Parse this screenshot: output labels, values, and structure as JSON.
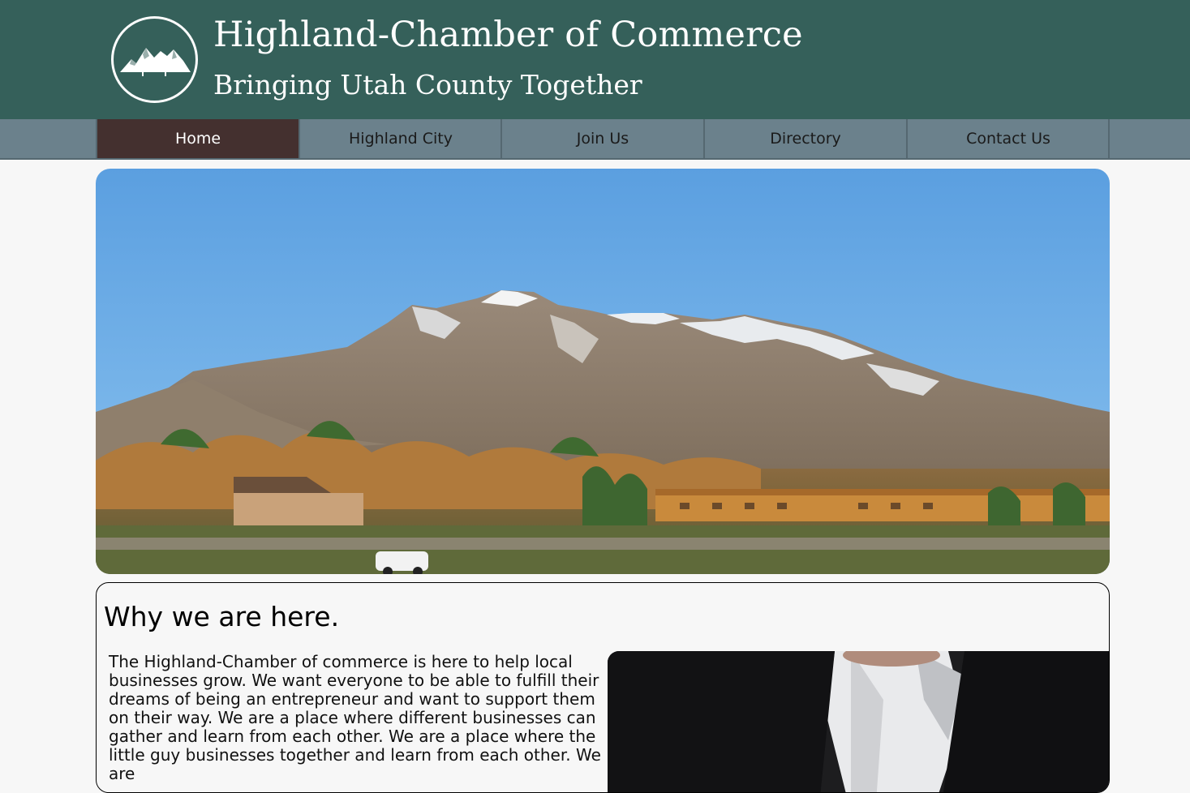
{
  "header": {
    "title": "Highland-Chamber of Commerce",
    "subtitle": "Bringing Utah County Together",
    "logo_icon": "mountain-logo-icon",
    "background_color": "#35605a"
  },
  "nav": {
    "items": [
      {
        "label": "Home",
        "active": true
      },
      {
        "label": "Highland City",
        "active": false
      },
      {
        "label": "Join Us",
        "active": false
      },
      {
        "label": "Directory",
        "active": false
      },
      {
        "label": "Contact Us",
        "active": false
      }
    ],
    "background_color": "#6b818c",
    "active_color": "#44302f"
  },
  "hero": {
    "image": "mountain-landscape"
  },
  "why": {
    "heading": "Why we are here.",
    "body": "The Highland-Chamber of commerce is here to help local businesses grow. We want everyone to be able to fulfill their dreams of being an entrepreneur and want to support them on their way. We are a place where different businesses can gather and learn from each other. We are a place where the little guy businesses together and learn from each other. We are",
    "image": "businessman-photo"
  }
}
